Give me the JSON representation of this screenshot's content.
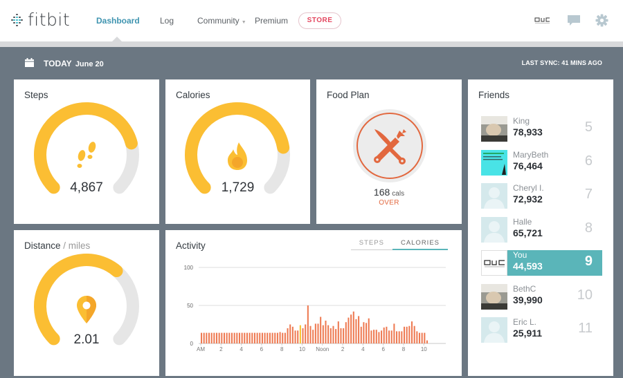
{
  "header": {
    "logo_text": "fitbit",
    "nav": [
      {
        "label": "Dashboard",
        "active": true
      },
      {
        "label": "Log",
        "active": false
      },
      {
        "label": "Community",
        "active": false,
        "has_dropdown": true
      },
      {
        "label": "Premium",
        "active": false
      }
    ],
    "store_label": "STORE",
    "profile_badge": "AJC",
    "icons": [
      "messages-icon",
      "settings-gear-icon"
    ]
  },
  "datebar": {
    "today_label": "TODAY",
    "date": "June 20",
    "last_sync": "LAST SYNC: 41 MINS AGO"
  },
  "tiles": {
    "steps": {
      "title": "Steps",
      "value": "4,867",
      "progress": 0.78
    },
    "calories": {
      "title": "Calories",
      "value": "1,729",
      "progress": 0.8
    },
    "food_plan": {
      "title": "Food Plan",
      "cals": "168",
      "unit": "cals",
      "status": "OVER"
    },
    "distance": {
      "title": "Distance",
      "unit_label": " / miles",
      "value": "2.01",
      "progress": 0.65
    },
    "activity": {
      "title": "Activity",
      "tabs": [
        {
          "label": "STEPS",
          "active": false
        },
        {
          "label": "CALORIES",
          "active": true
        }
      ]
    }
  },
  "friends": {
    "title": "Friends",
    "list": [
      {
        "name": "King",
        "steps": "78,933",
        "rank": "5",
        "avatar": "photo",
        "me": false
      },
      {
        "name": "MaryBeth",
        "steps": "76,464",
        "rank": "6",
        "avatar": "photo-cyan",
        "me": false
      },
      {
        "name": "Cheryl I.",
        "steps": "72,932",
        "rank": "7",
        "avatar": "default",
        "me": false
      },
      {
        "name": "Halle",
        "steps": "65,721",
        "rank": "8",
        "avatar": "default",
        "me": false
      },
      {
        "name": "You",
        "steps": "44,593",
        "rank": "9",
        "avatar": "ajc",
        "me": true
      },
      {
        "name": "BethC",
        "steps": "39,990",
        "rank": "10",
        "avatar": "photo",
        "me": false
      },
      {
        "name": "Eric L.",
        "steps": "25,911",
        "rank": "11",
        "avatar": "default",
        "me": false
      }
    ]
  },
  "colors": {
    "gauge_fill": "#fbbe33",
    "gauge_track": "#e6e6e6",
    "bar": "#ee7a52",
    "highlight_bar": "#f8c12c",
    "accent_teal": "#5ab5b9",
    "store_pink": "#e4465f",
    "food_orange": "#e2683f"
  },
  "chart_data": {
    "type": "bar",
    "title": "Activity",
    "series_name": "Calories",
    "xlabel": "",
    "ylabel": "",
    "ylim": [
      0,
      100
    ],
    "yticks": [
      0,
      50,
      100
    ],
    "xticks": [
      {
        "hour": 0,
        "label": "AM"
      },
      {
        "hour": 2,
        "label": "2"
      },
      {
        "hour": 4,
        "label": "4"
      },
      {
        "hour": 6,
        "label": "6"
      },
      {
        "hour": 8,
        "label": "8"
      },
      {
        "hour": 10,
        "label": "10"
      },
      {
        "hour": 12,
        "label": "Noon"
      },
      {
        "hour": 14,
        "label": "2"
      },
      {
        "hour": 16,
        "label": "4"
      },
      {
        "hour": 18,
        "label": "6"
      },
      {
        "hour": 20,
        "label": "8"
      },
      {
        "hour": 22,
        "label": "10"
      }
    ],
    "x_domain_hours": [
      0,
      24
    ],
    "interval_minutes": 15,
    "grid": true,
    "highlight_index": 39,
    "values": [
      14,
      14,
      14,
      14,
      14,
      14,
      14,
      14,
      14,
      14,
      14,
      14,
      14,
      14,
      14,
      14,
      14,
      14,
      14,
      14,
      14,
      14,
      14,
      14,
      14,
      14,
      14,
      14,
      14,
      14,
      14,
      15,
      14,
      14,
      20,
      25,
      22,
      17,
      17,
      24,
      20,
      25,
      50,
      23,
      18,
      26,
      26,
      35,
      24,
      30,
      24,
      20,
      23,
      19,
      29,
      20,
      20,
      28,
      34,
      38,
      42,
      32,
      36,
      22,
      28,
      27,
      33,
      17,
      18,
      18,
      15,
      17,
      21,
      22,
      17,
      17,
      26,
      16,
      16,
      16,
      22,
      22,
      23,
      29,
      23,
      16,
      14,
      14,
      14,
      4
    ]
  }
}
